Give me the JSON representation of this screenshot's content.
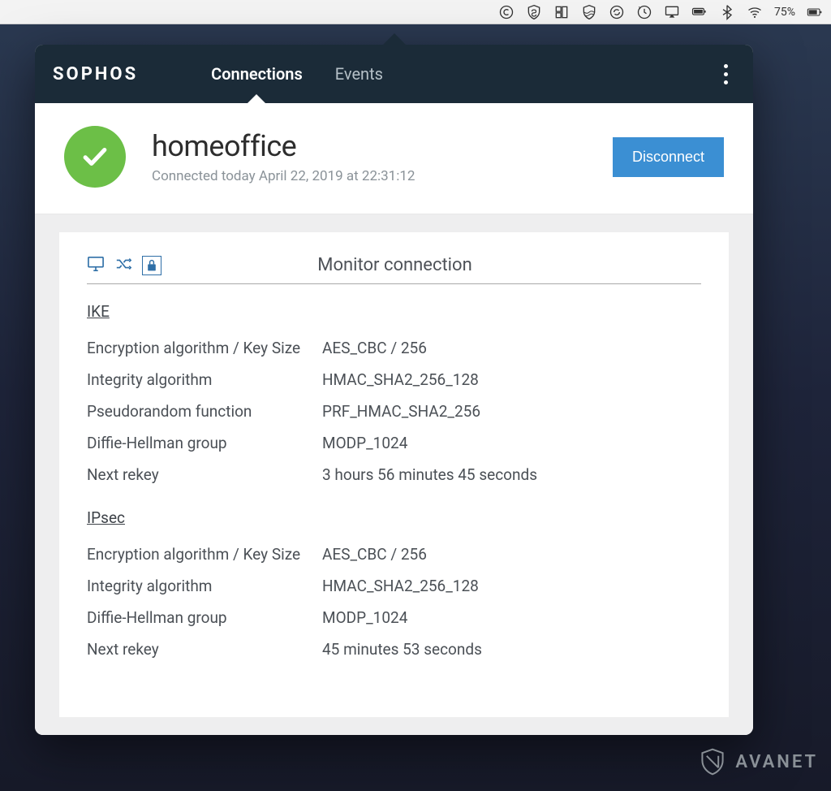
{
  "menubar": {
    "battery_pct": "75%"
  },
  "brand": "SOPHOS",
  "tabs": {
    "connections": "Connections",
    "events": "Events"
  },
  "connection": {
    "name": "homeoffice",
    "subtitle": "Connected today April 22, 2019 at 22:31:12",
    "disconnect_label": "Disconnect"
  },
  "monitor": {
    "title": "Monitor connection",
    "groups": {
      "ike": {
        "label": "IKE",
        "rows": {
          "enc": {
            "k": "Encryption algorithm / Key Size",
            "v": "AES_CBC / 256"
          },
          "int": {
            "k": "Integrity algorithm",
            "v": "HMAC_SHA2_256_128"
          },
          "prf": {
            "k": "Pseudorandom function",
            "v": "PRF_HMAC_SHA2_256"
          },
          "dh": {
            "k": "Diffie-Hellman group",
            "v": "MODP_1024"
          },
          "rek": {
            "k": "Next rekey",
            "v": "3 hours 56 minutes 45 seconds"
          }
        }
      },
      "ipsec": {
        "label": "IPsec",
        "rows": {
          "enc": {
            "k": "Encryption algorithm / Key Size",
            "v": "AES_CBC / 256"
          },
          "int": {
            "k": "Integrity algorithm",
            "v": "HMAC_SHA2_256_128"
          },
          "dh": {
            "k": "Diffie-Hellman group",
            "v": "MODP_1024"
          },
          "rek": {
            "k": "Next rekey",
            "v": "45 minutes 53 seconds"
          }
        }
      }
    }
  },
  "watermark": "AVANET"
}
